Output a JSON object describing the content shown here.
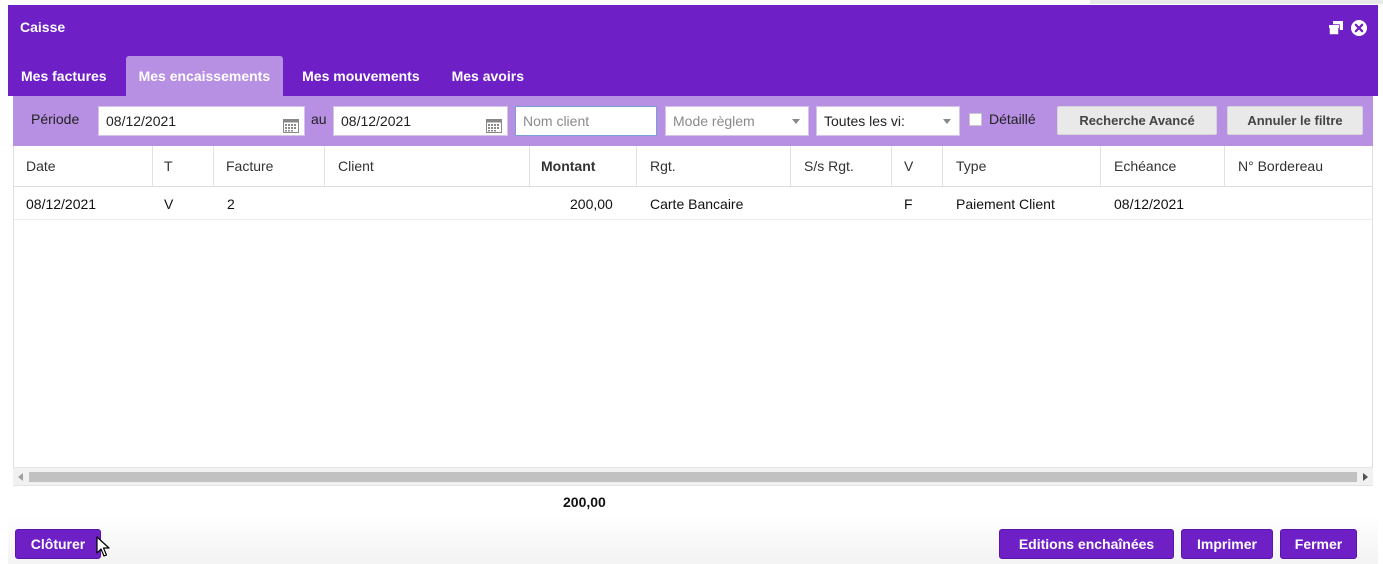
{
  "window": {
    "title": "Caisse",
    "restore_icon": "restore-window-icon",
    "close_icon": "close-circle-icon",
    "accent_color": "#6e1fc6",
    "tab_active_color": "#b78fe3"
  },
  "tabs": [
    {
      "label": "Mes factures",
      "active": false
    },
    {
      "label": "Mes encaissements",
      "active": true
    },
    {
      "label": "Mes mouvements",
      "active": false
    },
    {
      "label": "Mes avoirs",
      "active": false
    }
  ],
  "filters": {
    "periode_label": "Période",
    "date_from": "08/12/2021",
    "au_label": "au",
    "date_to": "08/12/2021",
    "client_placeholder": "Nom client",
    "mode_placeholder": "Mode règlem",
    "visites_value": "Toutes les vi:",
    "detaille_label": "Détaillé",
    "detaille_checked": false,
    "advanced_search_label": "Recherche Avancé",
    "cancel_filter_label": "Annuler le filtre"
  },
  "table": {
    "columns": [
      "Date",
      "T",
      "Facture",
      "Client",
      "Montant",
      "Rgt.",
      "S/s Rgt.",
      "V",
      "Type",
      "Echéance",
      "N° Bordereau"
    ],
    "rows": [
      {
        "date": "08/12/2021",
        "t": "V",
        "facture": "2",
        "client": "",
        "montant": "200,00",
        "rgt": "Carte Bancaire",
        "ss_rgt": "",
        "v": "F",
        "type": "Paiement Client",
        "echeance": "08/12/2021",
        "bordereau": ""
      }
    ],
    "total_montant": "200,00"
  },
  "actions": {
    "cloturer": "Clôturer",
    "editions": "Editions enchaînées",
    "imprimer": "Imprimer",
    "fermer": "Fermer"
  }
}
